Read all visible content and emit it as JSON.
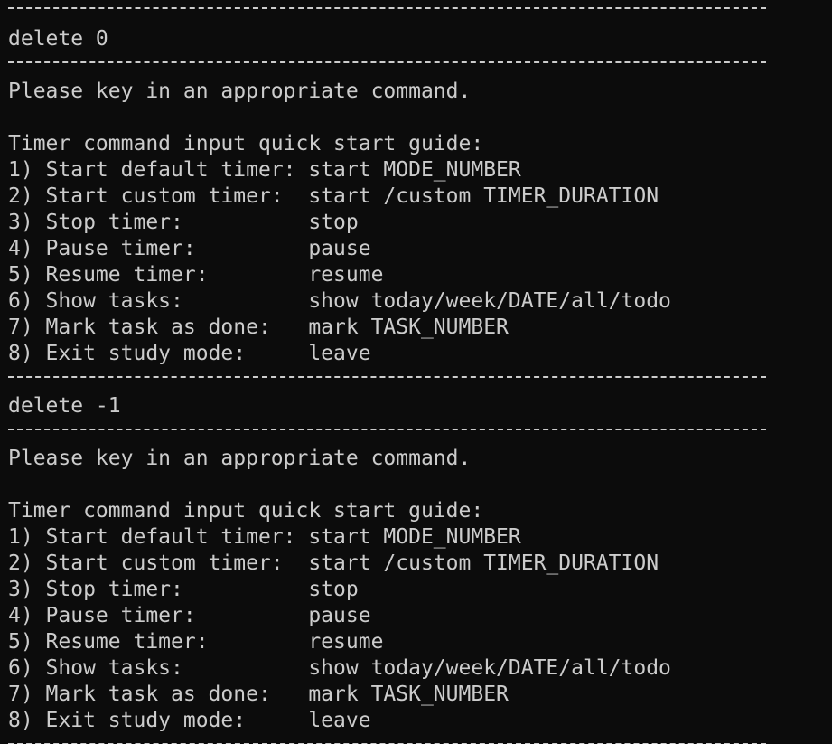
{
  "terminal": {
    "lines": [
      {
        "type": "sep"
      },
      {
        "type": "text",
        "text": "delete 0"
      },
      {
        "type": "sep"
      },
      {
        "type": "text",
        "text": "Please key in an appropriate command."
      },
      {
        "type": "text",
        "text": ""
      },
      {
        "type": "text",
        "text": "Timer command input quick start guide:"
      },
      {
        "type": "text",
        "text": "1) Start default timer: start MODE_NUMBER"
      },
      {
        "type": "text",
        "text": "2) Start custom timer:  start /custom TIMER_DURATION"
      },
      {
        "type": "text",
        "text": "3) Stop timer:          stop"
      },
      {
        "type": "text",
        "text": "4) Pause timer:         pause"
      },
      {
        "type": "text",
        "text": "5) Resume timer:        resume"
      },
      {
        "type": "text",
        "text": "6) Show tasks:          show today/week/DATE/all/todo"
      },
      {
        "type": "text",
        "text": "7) Mark task as done:   mark TASK_NUMBER"
      },
      {
        "type": "text",
        "text": "8) Exit study mode:     leave"
      },
      {
        "type": "sep"
      },
      {
        "type": "text",
        "text": "delete -1"
      },
      {
        "type": "sep"
      },
      {
        "type": "text",
        "text": "Please key in an appropriate command."
      },
      {
        "type": "text",
        "text": ""
      },
      {
        "type": "text",
        "text": "Timer command input quick start guide:"
      },
      {
        "type": "text",
        "text": "1) Start default timer: start MODE_NUMBER"
      },
      {
        "type": "text",
        "text": "2) Start custom timer:  start /custom TIMER_DURATION"
      },
      {
        "type": "text",
        "text": "3) Stop timer:          stop"
      },
      {
        "type": "text",
        "text": "4) Pause timer:         pause"
      },
      {
        "type": "text",
        "text": "5) Resume timer:        resume"
      },
      {
        "type": "text",
        "text": "6) Show tasks:          show today/week/DATE/all/todo"
      },
      {
        "type": "text",
        "text": "7) Mark task as done:   mark TASK_NUMBER"
      },
      {
        "type": "text",
        "text": "8) Exit study mode:     leave"
      },
      {
        "type": "sep"
      }
    ]
  },
  "colors": {
    "background": "#0c0c0c",
    "foreground": "#cccccc"
  }
}
